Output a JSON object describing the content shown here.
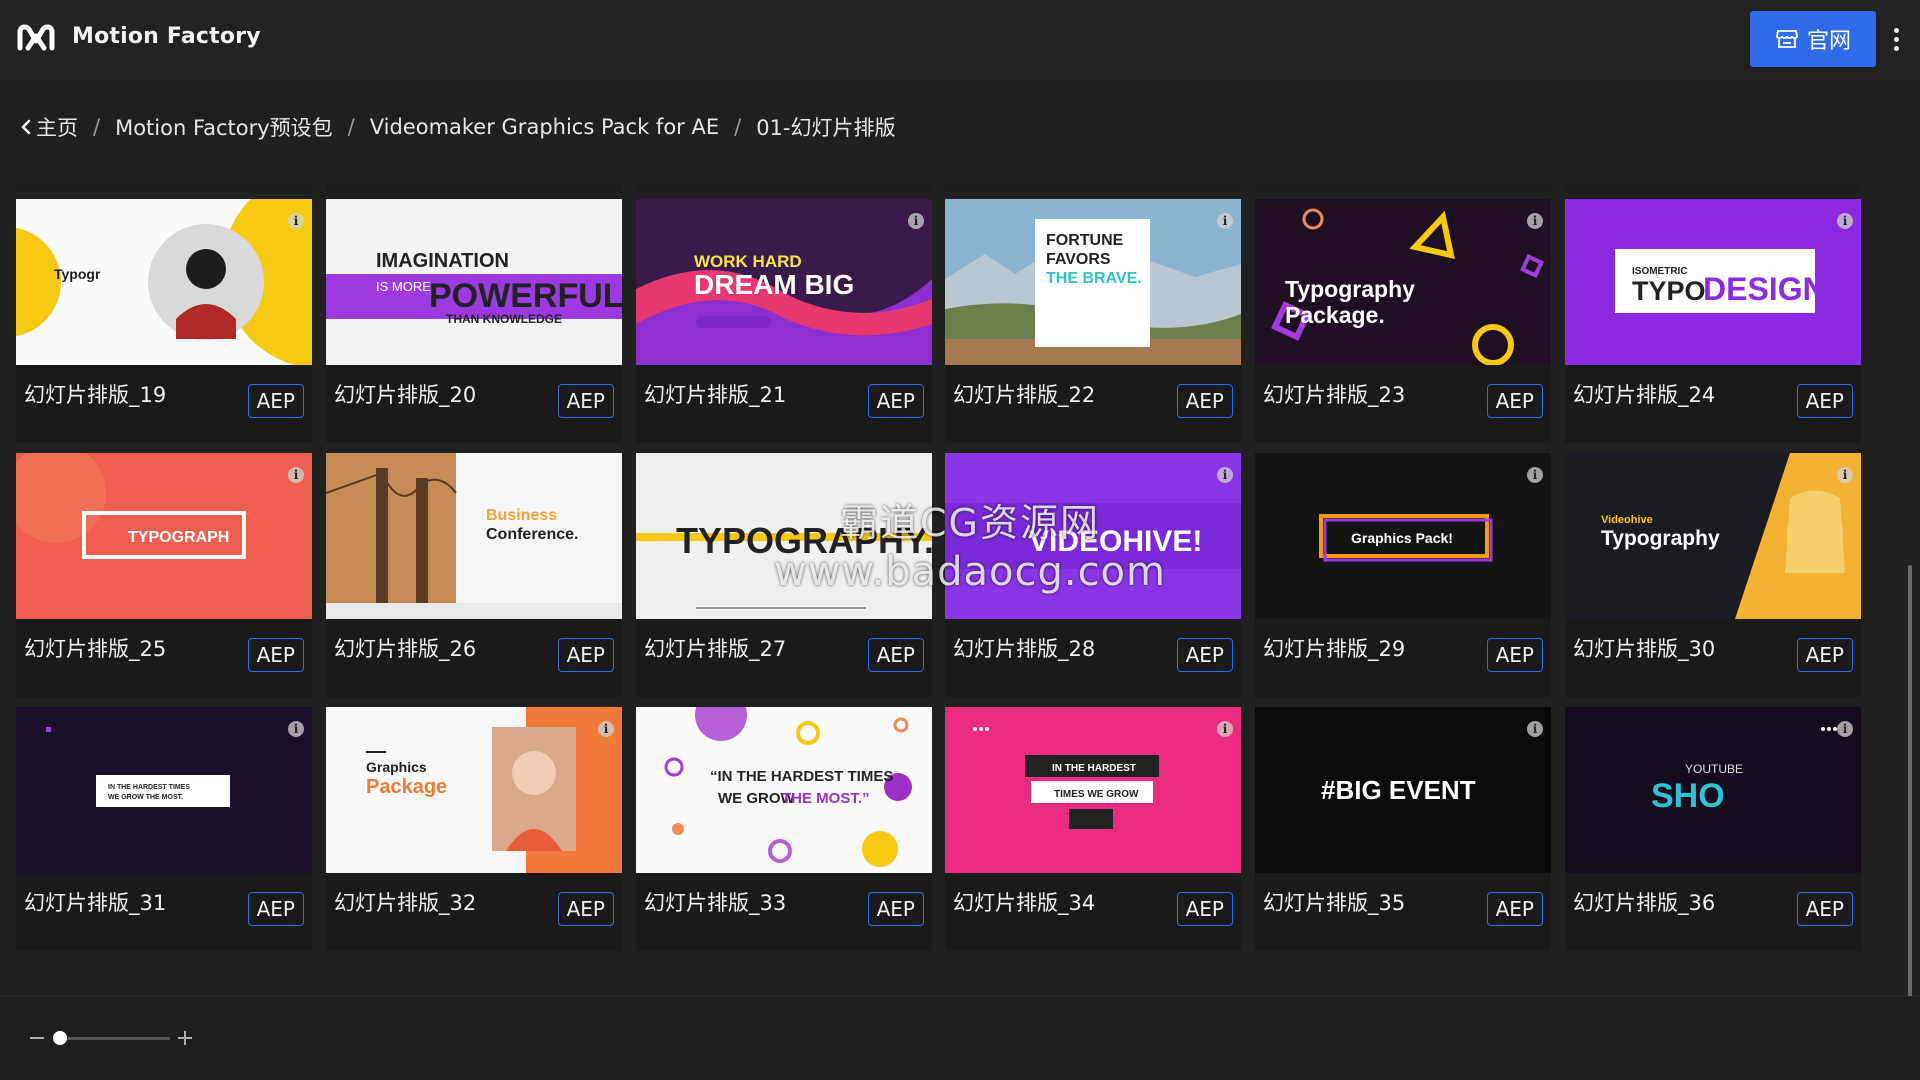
{
  "app": {
    "title": "Motion Factory"
  },
  "header": {
    "site_button_label": "官网"
  },
  "breadcrumb": {
    "items": [
      "主页",
      "Motion Factory预设包",
      "Videomaker Graphics Pack for AE",
      "01-幻灯片排版"
    ]
  },
  "colors": {
    "accent": "#2f6be6",
    "background": "#202020",
    "card": "#1a1a1a"
  },
  "cards": [
    {
      "name": "幻灯片排版_19",
      "tag": "AEP",
      "title_text": "Typogr"
    },
    {
      "name": "幻灯片排版_20",
      "tag": "AEP",
      "line1": "IMAGINATION",
      "line2": "IS MORE",
      "line3": "POWERFUL",
      "line4": "THAN KNOWLEDGE"
    },
    {
      "name": "幻灯片排版_21",
      "tag": "AEP",
      "line1": "WORK HARD",
      "line2": "DREAM BIG"
    },
    {
      "name": "幻灯片排版_22",
      "tag": "AEP",
      "line1": "FORTUNE",
      "line2": "FAVORS",
      "line3": "THE BRAVE."
    },
    {
      "name": "幻灯片排版_23",
      "tag": "AEP",
      "line1": "Typography",
      "line2": "Package."
    },
    {
      "name": "幻灯片排版_24",
      "tag": "AEP",
      "line1": "ISOMETRIC",
      "line2": "TYPO",
      "line3": "DESIGN"
    },
    {
      "name": "幻灯片排版_25",
      "tag": "AEP",
      "line1": "TYPOGRAPH"
    },
    {
      "name": "幻灯片排版_26",
      "tag": "AEP",
      "line1": "Business",
      "line2": "Conference."
    },
    {
      "name": "幻灯片排版_27",
      "tag": "AEP",
      "line1": "TYPOGRAPHY."
    },
    {
      "name": "幻灯片排版_28",
      "tag": "AEP",
      "line1": "VIDEOHIVE!"
    },
    {
      "name": "幻灯片排版_29",
      "tag": "AEP",
      "line1": "Graphics Pack!"
    },
    {
      "name": "幻灯片排版_30",
      "tag": "AEP",
      "line1": "Videohive",
      "line2": "Typography"
    },
    {
      "name": "幻灯片排版_31",
      "tag": "AEP",
      "line1": "IN THE HARDEST TIMES",
      "line2": "WE GROW THE MOST."
    },
    {
      "name": "幻灯片排版_32",
      "tag": "AEP",
      "line1": "Graphics",
      "line2": "Package"
    },
    {
      "name": "幻灯片排版_33",
      "tag": "AEP",
      "line1": "“IN THE HARDEST TIMES",
      "line2": "WE GROW",
      "line3": "THE MOST.”"
    },
    {
      "name": "幻灯片排版_34",
      "tag": "AEP",
      "line1": "IN THE HARDEST",
      "line2": "TIMES WE GROW"
    },
    {
      "name": "幻灯片排版_35",
      "tag": "AEP",
      "line1": "#BIG EVENT"
    },
    {
      "name": "幻灯片排版_36",
      "tag": "AEP",
      "line1": "YOUTUBE",
      "line2": "SHO"
    }
  ],
  "watermark": {
    "line1": "霸道CG资源网",
    "line2": "www.badaocg.com"
  },
  "zoom": {
    "level": 0.05
  }
}
